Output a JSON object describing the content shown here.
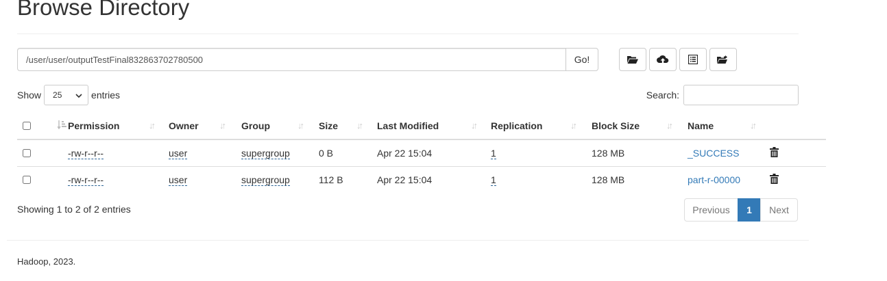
{
  "page": {
    "title": "Browse Directory"
  },
  "path_bar": {
    "value": "/user/user/outputTestFinal832863702780500",
    "go_label": "Go!"
  },
  "toolbar": [
    {
      "icon": "folder-open-icon"
    },
    {
      "icon": "cloud-upload-icon"
    },
    {
      "icon": "list-alt-icon"
    },
    {
      "icon": "folder-move-icon"
    }
  ],
  "length": {
    "prefix": "Show",
    "value": "25",
    "suffix": "entries"
  },
  "search": {
    "label": "Search:",
    "value": ""
  },
  "table": {
    "headers": {
      "permission": "Permission",
      "owner": "Owner",
      "group": "Group",
      "size": "Size",
      "last_modified": "Last Modified",
      "replication": "Replication",
      "block_size": "Block Size",
      "name": "Name"
    },
    "rows": [
      {
        "permission": "-rw-r--r--",
        "owner": "user",
        "group": "supergroup",
        "size": "0 B",
        "last_modified": "Apr 22 15:04",
        "replication": "1",
        "block_size": "128 MB",
        "name": "_SUCCESS"
      },
      {
        "permission": "-rw-r--r--",
        "owner": "user",
        "group": "supergroup",
        "size": "112 B",
        "last_modified": "Apr 22 15:04",
        "replication": "1",
        "block_size": "128 MB",
        "name": "part-r-00000"
      }
    ]
  },
  "info": "Showing 1 to 2 of 2 entries",
  "pagination": {
    "previous": "Previous",
    "current": "1",
    "next": "Next"
  },
  "footer": "Hadoop, 2023.",
  "colors": {
    "link": "#337ab7",
    "active_page": "#337ab7"
  }
}
